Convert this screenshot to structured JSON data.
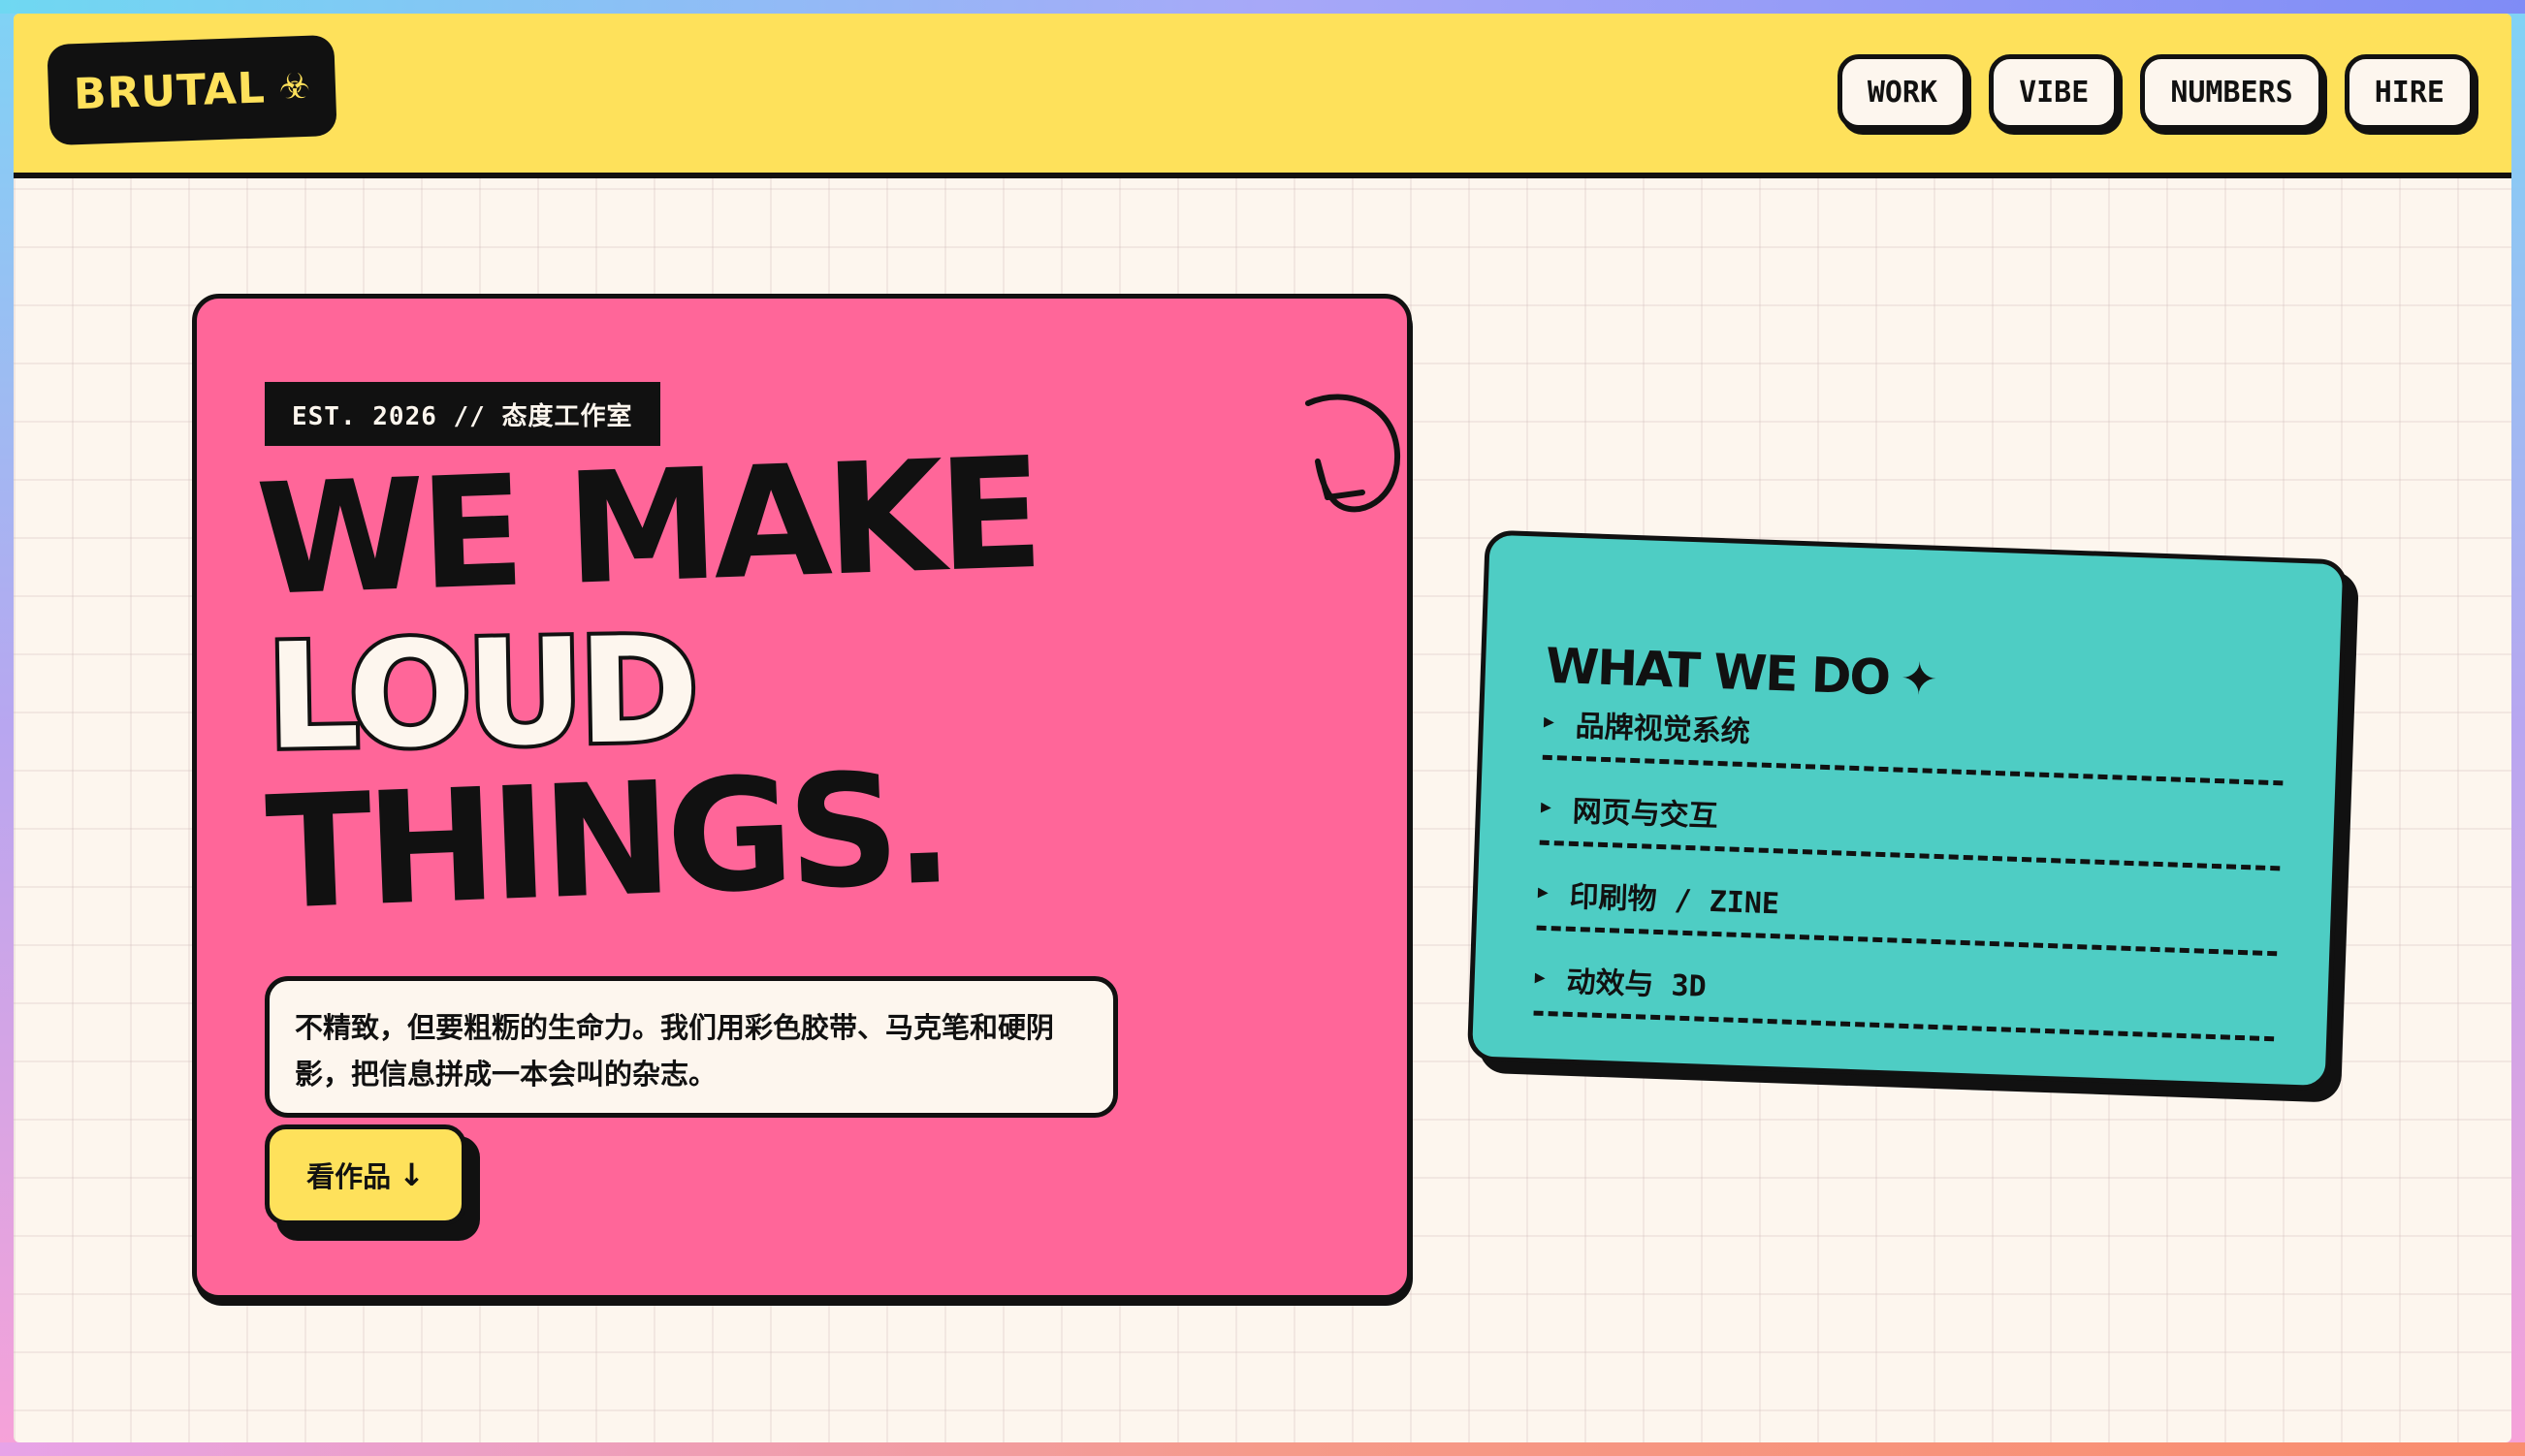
{
  "header": {
    "logo_text": "BRUTAL",
    "logo_icon": "☣",
    "nav": [
      {
        "label": "WORK"
      },
      {
        "label": "VIBE"
      },
      {
        "label": "NUMBERS"
      },
      {
        "label": "HIRE"
      }
    ]
  },
  "hero": {
    "tag": "EST. 2026 // 态度工作室",
    "headline": {
      "line1": "WE MAKE",
      "line2": "LOUD",
      "line3": "THINGS."
    },
    "description": "不精致，但要粗粝的生命力。我们用彩色胶带、马克笔和硬阴影，把信息拼成一本会叫的杂志。",
    "cta_label": "看作品",
    "cta_arrow": "↓"
  },
  "services": {
    "title": "WHAT WE DO",
    "title_icon": "✦",
    "items": [
      {
        "label": "品牌视觉系统"
      },
      {
        "label": "网页与交互"
      },
      {
        "label": "印刷物 / ZINE"
      },
      {
        "label": "动效与 3D"
      }
    ]
  },
  "colors": {
    "yellow": "#fee15b",
    "pink": "#ff6699",
    "teal": "#4ecdc4",
    "ink": "#111111",
    "paper": "#fdf6ee"
  }
}
